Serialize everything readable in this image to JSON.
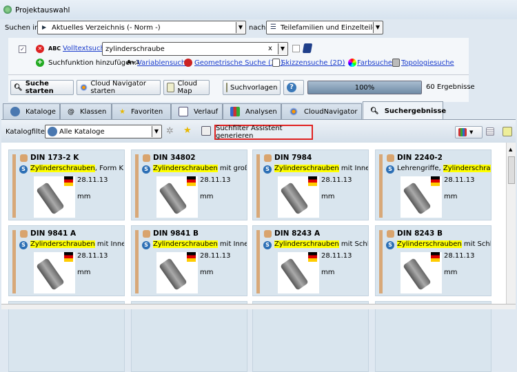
{
  "window": {
    "title": "Projektauswahl"
  },
  "search": {
    "in_label": "Suchen in",
    "in_value": "Aktuelles Verzeichnis (- Norm -)",
    "nach_label": "nach",
    "nach_value": "Teilefamilien und Einzelteilen",
    "abc": "ABC",
    "fulltext_link": "Volltextsuche",
    "query": "zylinderschraube",
    "clear": "x",
    "add_label": "Suchfunktion hinzufügen:",
    "var_prefix": "A=3",
    "functions": [
      "Variablensuche",
      "Geometrische Suche (3D)",
      "Skizzensuche (2D)",
      "Farbsuche",
      "Topologiesuche"
    ]
  },
  "actions": {
    "start": "Suche starten",
    "cloud_nav": "Cloud Navigator starten",
    "cloud_map": "Cloud Map",
    "templates": "Suchvorlagen",
    "progress_label": "100%",
    "progress": 100,
    "results": "60 Ergebnisse"
  },
  "tabs": [
    "Kataloge",
    "Klassen",
    "Favoriten",
    "Verlauf",
    "Analysen",
    "CloudNavigator",
    "Suchergebnisse"
  ],
  "filter": {
    "label": "Katalogfilter:",
    "value": "Alle Kataloge",
    "assistant": "Suchfilter Assistent generieren"
  },
  "cards": [
    {
      "name": "DIN 173-2 K",
      "hl": "Zylinderschrauben",
      "rest": ", Form K",
      "date": "28.11.13",
      "unit": "mm"
    },
    {
      "name": "DIN 34802",
      "hl": "Zylinderschrauben",
      "rest": " mit großem Ir",
      "date": "28.11.13",
      "unit": "mm"
    },
    {
      "name": "DIN 7984",
      "hl": "Zylinderschrauben",
      "rest": " mit Innensec",
      "date": "28.11.13",
      "unit": "mm"
    },
    {
      "name": "DIN 2240-2",
      "pre": "Lehrengriffe, ",
      "hl": "Zylinderschrauben",
      "rest": "",
      "date": "28.11.13",
      "unit": "mm"
    },
    {
      "name": "DIN 9841 A",
      "hl": "Zylinderschrauben",
      "rest": " mit Innensec",
      "date": "28.11.13",
      "unit": "mm"
    },
    {
      "name": "DIN 9841 B",
      "hl": "Zylinderschrauben",
      "rest": " mit Innensec",
      "date": "28.11.13",
      "unit": "mm"
    },
    {
      "name": "DIN 8243 A",
      "hl": "Zylinderschrauben",
      "rest": " mit Schlitz für",
      "date": "28.11.13",
      "unit": "mm"
    },
    {
      "name": "DIN 8243 B",
      "hl": "Zylinderschrauben",
      "rest": " mit Schlitz für",
      "date": "28.11.13",
      "unit": "mm"
    }
  ]
}
